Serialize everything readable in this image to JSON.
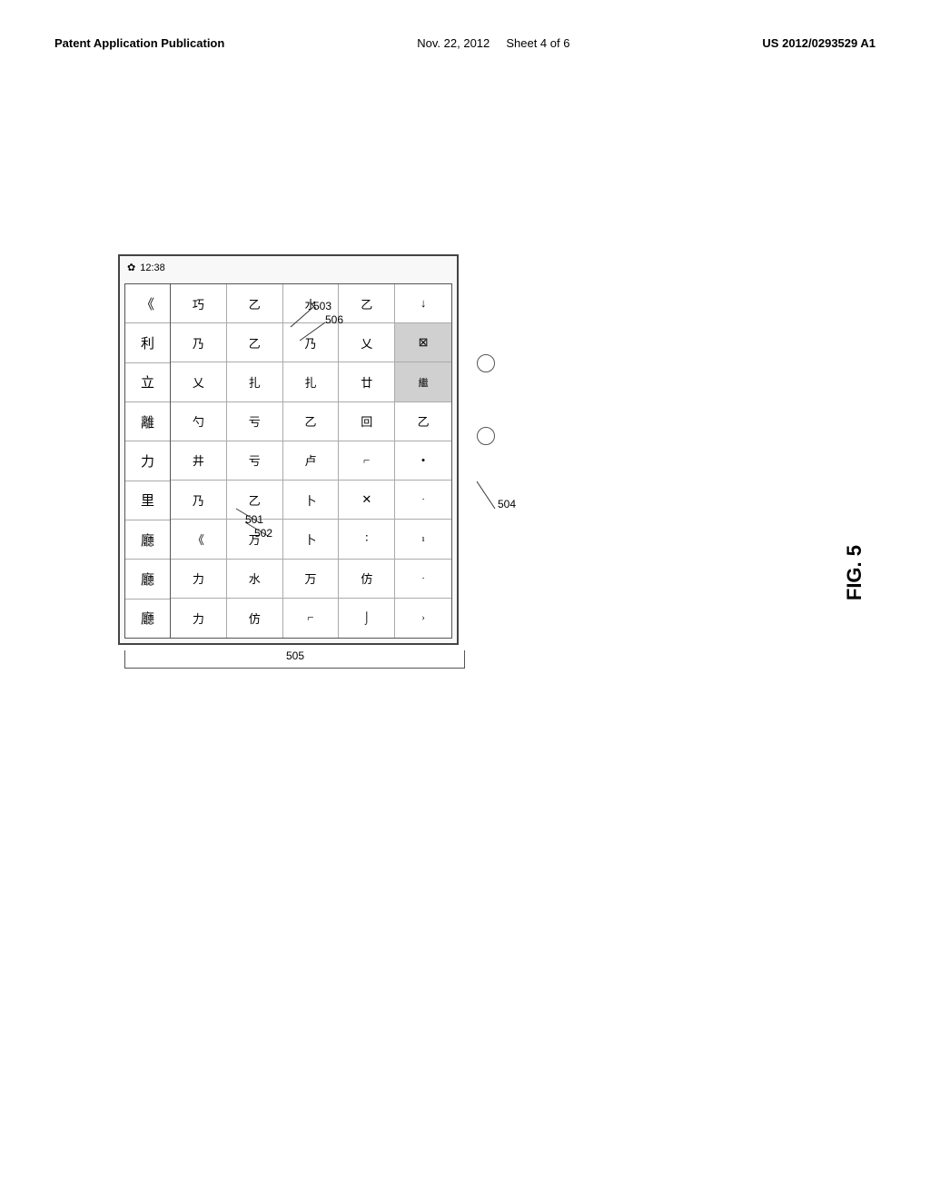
{
  "header": {
    "left": "Patent Application Publication",
    "center_date": "Nov. 22, 2012",
    "center_sheet": "Sheet 4 of 6",
    "right": "US 2012/0293529 A1"
  },
  "figure": {
    "label": "FIG. 5",
    "status_bar": {
      "icon": "✿",
      "time": "12:38"
    },
    "ref_labels": {
      "r501": "501",
      "r502": "502",
      "r503": "503",
      "r504": "504",
      "r505": "505",
      "r506": "506"
    },
    "left_column_chars": [
      "《",
      "利",
      "立",
      "離",
      "力",
      "里",
      "廳"
    ],
    "key_rows": [
      [
        "巧",
        "乙",
        "水",
        "乙",
        "↓"
      ],
      [
        "乃",
        "乙",
        "乃",
        "乂",
        "⊠"
      ],
      [
        "乂",
        "扎",
        "扎",
        "廿",
        "繼"
      ],
      [
        "勺",
        "亏",
        "乙",
        "回",
        "乙"
      ],
      [
        "井",
        "亏",
        "卢",
        "⌐",
        "•"
      ],
      [
        "乃",
        "乙",
        "卜",
        "✕",
        "·"
      ],
      [
        "《",
        "万",
        "卜",
        "∶",
        "ı"
      ],
      [
        "力",
        "水",
        "万",
        "仿",
        "·"
      ],
      [
        "力",
        "仿",
        "⌐",
        "⌡",
        "›"
      ]
    ]
  }
}
